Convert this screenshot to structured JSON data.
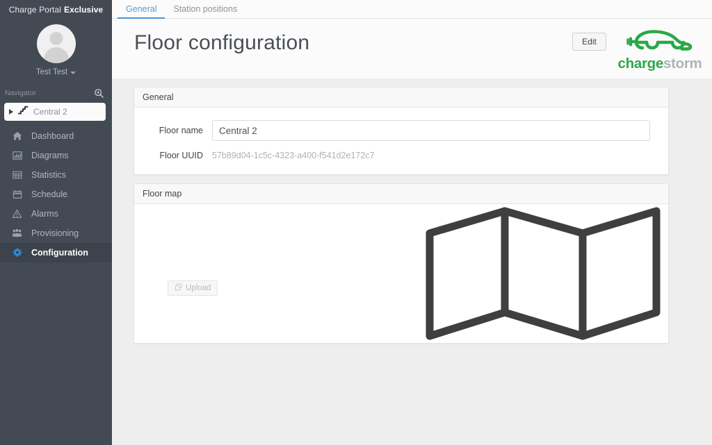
{
  "sidebar": {
    "brand": {
      "light": "Charge Portal",
      "bold": "Exclusive"
    },
    "user": {
      "name": "Test Test",
      "avatar_icon": "user-avatar-icon",
      "caret_icon": "chevron-down-icon"
    },
    "navigator": {
      "label": "Navigator",
      "search_icon": "search-zoom-icon"
    },
    "tree": {
      "expand_icon": "triangle-right-icon",
      "node_icon": "stairs-icon",
      "label": "Central 2"
    },
    "items": [
      {
        "label": "Dashboard",
        "icon": "home-icon",
        "active": false
      },
      {
        "label": "Diagrams",
        "icon": "bar-chart-icon",
        "active": false
      },
      {
        "label": "Statistics",
        "icon": "table-grid-icon",
        "active": false
      },
      {
        "label": "Schedule",
        "icon": "calendar-icon",
        "active": false
      },
      {
        "label": "Alarms",
        "icon": "warning-triangle-icon",
        "active": false
      },
      {
        "label": "Provisioning",
        "icon": "users-group-icon",
        "active": false
      },
      {
        "label": "Configuration",
        "icon": "gear-icon",
        "active": true
      }
    ]
  },
  "tabs": [
    {
      "label": "General",
      "active": true
    },
    {
      "label": "Station positions",
      "active": false
    }
  ],
  "header": {
    "title": "Floor configuration",
    "edit_label": "Edit",
    "logo": {
      "word1": "charge",
      "word2": "storm",
      "icon": "ev-car-plug-icon",
      "color": "#2ba84a"
    }
  },
  "general_panel": {
    "title": "General",
    "floor_name": {
      "label": "Floor name",
      "value": "Central 2"
    },
    "floor_uuid": {
      "label": "Floor UUID",
      "value": "57b89d04-1c5c-4323-a400-f541d2e172c7"
    }
  },
  "floor_map_panel": {
    "title": "Floor map",
    "upload_label": "Upload",
    "upload_icon": "copy-files-icon",
    "placeholder_icon": "folded-map-icon"
  },
  "colors": {
    "sidebar_bg": "#434a54",
    "accent_blue": "#4a90d9",
    "active_icon_blue": "#2f8fe0",
    "brand_green": "#2ba84a",
    "page_bg": "#eeeeee"
  }
}
